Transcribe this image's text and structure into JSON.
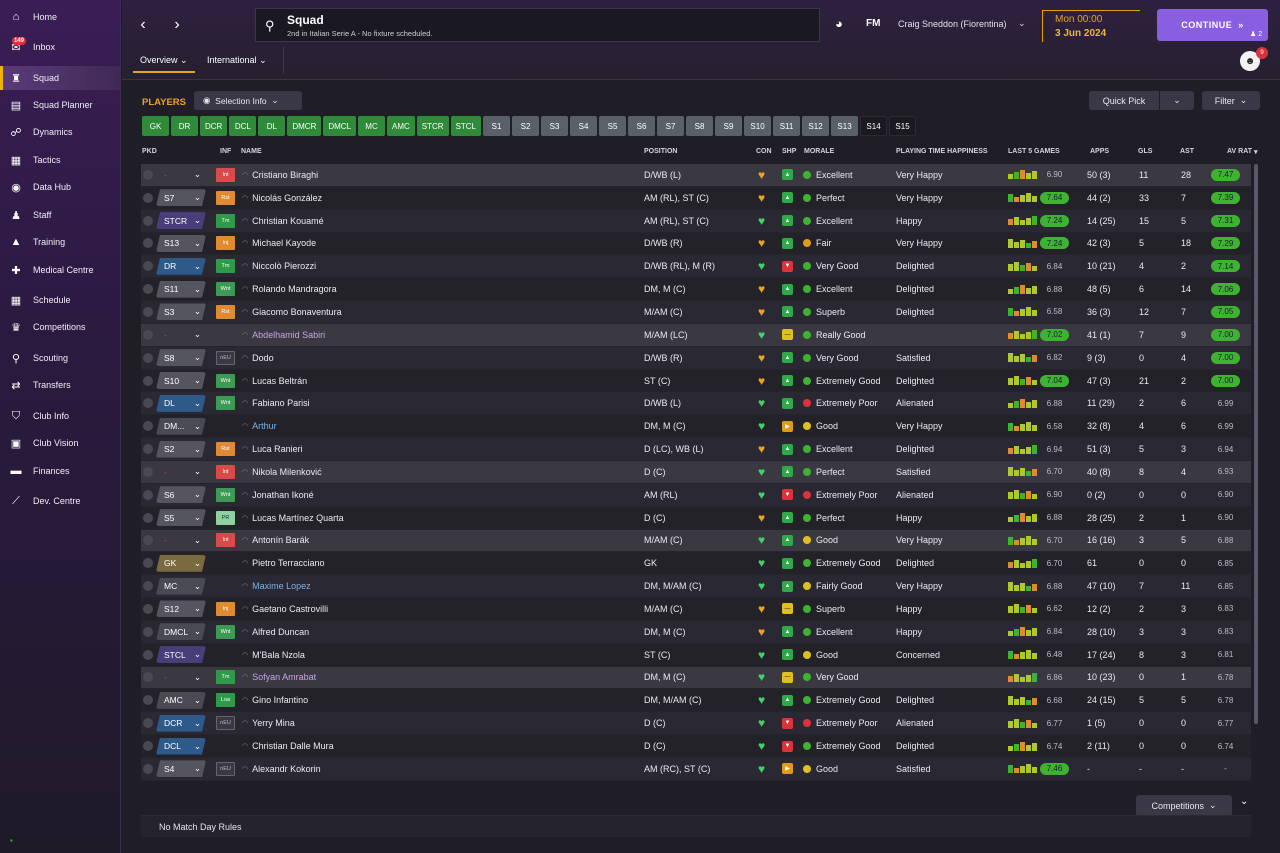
{
  "sidebar": {
    "items": [
      {
        "label": "Home",
        "icon": "home-icon",
        "glyph": "⌂"
      },
      {
        "label": "Inbox",
        "icon": "inbox-icon",
        "glyph": "✉",
        "badge": "149"
      },
      {
        "label": "Squad",
        "icon": "squad-icon",
        "glyph": "♜",
        "active": true
      },
      {
        "label": "Squad Planner",
        "icon": "planner-icon",
        "glyph": "▤"
      },
      {
        "label": "Dynamics",
        "icon": "dynamics-icon",
        "glyph": "☍"
      },
      {
        "label": "Tactics",
        "icon": "tactics-icon",
        "glyph": "▦"
      },
      {
        "label": "Data Hub",
        "icon": "datahub-icon",
        "glyph": "◉"
      },
      {
        "label": "Staff",
        "icon": "staff-icon",
        "glyph": "♟"
      },
      {
        "label": "Training",
        "icon": "training-icon",
        "glyph": "▲"
      },
      {
        "label": "Medical Centre",
        "icon": "medical-icon",
        "glyph": "✚"
      },
      {
        "label": "Schedule",
        "icon": "schedule-icon",
        "glyph": "▦"
      },
      {
        "label": "Competitions",
        "icon": "trophy-icon",
        "glyph": "♛"
      },
      {
        "label": "Scouting",
        "icon": "scouting-icon",
        "glyph": "⚲"
      },
      {
        "label": "Transfers",
        "icon": "transfers-icon",
        "glyph": "⇄"
      },
      {
        "label": "Club Info",
        "icon": "club-info-icon",
        "glyph": "⛉"
      },
      {
        "label": "Club Vision",
        "icon": "club-vision-icon",
        "glyph": "▣"
      },
      {
        "label": "Finances",
        "icon": "finances-icon",
        "glyph": "▬"
      },
      {
        "label": "Dev. Centre",
        "icon": "dev-centre-icon",
        "glyph": "⟋"
      }
    ]
  },
  "header": {
    "title": "Squad",
    "subtitle": "2nd in Italian Serie A - No fixture scheduled.",
    "fm": "FM",
    "manager": "Craig Sneddon (Fiorentina)",
    "time": "Mon 00:00",
    "date": "3 Jun 2024",
    "continue": "CONTINUE",
    "users": "2",
    "notifications": "9"
  },
  "tabs": [
    "Overview",
    "International"
  ],
  "toolbar": {
    "players": "PLAYERS",
    "selection_info": "Selection Info",
    "quick_pick": "Quick Pick",
    "filter": "Filter"
  },
  "positions": [
    {
      "label": "GK",
      "style": "g"
    },
    {
      "label": "DR",
      "style": "g"
    },
    {
      "label": "DCR",
      "style": "g"
    },
    {
      "label": "DCL",
      "style": "g"
    },
    {
      "label": "DL",
      "style": "g"
    },
    {
      "label": "DMCR",
      "style": "g"
    },
    {
      "label": "DMCL",
      "style": "g"
    },
    {
      "label": "MC",
      "style": "g"
    },
    {
      "label": "AMC",
      "style": "g"
    },
    {
      "label": "STCR",
      "style": "g"
    },
    {
      "label": "STCL",
      "style": "g"
    },
    {
      "label": "S1",
      "style": "s"
    },
    {
      "label": "S2",
      "style": "s"
    },
    {
      "label": "S3",
      "style": "s"
    },
    {
      "label": "S4",
      "style": "s"
    },
    {
      "label": "S5",
      "style": "s"
    },
    {
      "label": "S6",
      "style": "s"
    },
    {
      "label": "S7",
      "style": "s"
    },
    {
      "label": "S8",
      "style": "s"
    },
    {
      "label": "S9",
      "style": "s"
    },
    {
      "label": "S10",
      "style": "s"
    },
    {
      "label": "S11",
      "style": "s"
    },
    {
      "label": "S12",
      "style": "s"
    },
    {
      "label": "S13",
      "style": "s"
    },
    {
      "label": "S14",
      "style": "d"
    },
    {
      "label": "S15",
      "style": "d"
    }
  ],
  "columns": [
    "PKD",
    "INF",
    "NAME",
    "POSITION",
    "CON",
    "SHP",
    "MORALE",
    "PLAYING TIME HAPPINESS",
    "LAST 5 GAMES",
    "APPS",
    "GLS",
    "AST",
    "AV RAT"
  ],
  "rows": [
    {
      "pkd": "-",
      "inf": "Int",
      "name": "Cristiano Biraghi",
      "pos": "D/WB (L)",
      "con": "orange",
      "shp": "g",
      "morale": "Excellent",
      "mc": "g",
      "pth": "Very Happy",
      "form": "6.90",
      "fh": false,
      "apps": "50 (3)",
      "gls": "11",
      "ast": "28",
      "rat": "7.47",
      "rh": true
    },
    {
      "pkd": "S7",
      "inf": "Rst",
      "name": "Nicolás González",
      "pos": "AM (RL), ST (C)",
      "con": "orange",
      "shp": "g",
      "morale": "Perfect",
      "mc": "g",
      "pth": "Very Happy",
      "form": "7.64",
      "fh": true,
      "apps": "44 (2)",
      "gls": "33",
      "ast": "7",
      "rat": "7.39",
      "rh": true
    },
    {
      "pkd": "STCR",
      "inf": "Tm",
      "name": "Christian Kouamé",
      "pos": "AM (RL), ST (C)",
      "con": "green",
      "shp": "g",
      "morale": "Excellent",
      "mc": "g",
      "pth": "Happy",
      "form": "7.24",
      "fh": true,
      "apps": "14 (25)",
      "gls": "15",
      "ast": "5",
      "rat": "7.31",
      "rh": true
    },
    {
      "pkd": "S13",
      "inf": "Inj",
      "name": "Michael Kayode",
      "pos": "D/WB (R)",
      "con": "orange",
      "shp": "g",
      "morale": "Fair",
      "mc": "o",
      "pth": "Very Happy",
      "form": "7.24",
      "fh": true,
      "apps": "42 (3)",
      "gls": "5",
      "ast": "18",
      "rat": "7.29",
      "rh": true
    },
    {
      "pkd": "DR",
      "inf": "Tm",
      "name": "Niccolò Pierozzi",
      "pos": "D/WB (RL), M (R)",
      "con": "green",
      "shp": "r",
      "morale": "Very Good",
      "mc": "g",
      "pth": "Delighted",
      "form": "6.84",
      "fh": false,
      "apps": "10 (21)",
      "gls": "4",
      "ast": "2",
      "rat": "7.14",
      "rh": true
    },
    {
      "pkd": "S11",
      "inf": "Wnt",
      "name": "Rolando Mandragora",
      "pos": "DM, M (C)",
      "con": "orange",
      "shp": "g",
      "morale": "Excellent",
      "mc": "g",
      "pth": "Delighted",
      "form": "6.88",
      "fh": false,
      "apps": "48 (5)",
      "gls": "6",
      "ast": "14",
      "rat": "7.06",
      "rh": true
    },
    {
      "pkd": "S3",
      "inf": "Rst",
      "name": "Giacomo Bonaventura",
      "pos": "M/AM (C)",
      "con": "orange",
      "shp": "g",
      "morale": "Superb",
      "mc": "g",
      "pth": "Delighted",
      "form": "6.58",
      "fh": false,
      "apps": "36 (3)",
      "gls": "12",
      "ast": "7",
      "rat": "7.05",
      "rh": true
    },
    {
      "pkd": "-",
      "inf": "",
      "name": "Abdelhamid Sabiri",
      "pos": "M/AM (LC)",
      "con": "green",
      "shp": "y",
      "morale": "Really Good",
      "mc": "g",
      "pth": "",
      "form": "7.02",
      "fh": true,
      "apps": "41 (1)",
      "gls": "7",
      "ast": "9",
      "rat": "7.00",
      "rh": true
    },
    {
      "pkd": "S8",
      "inf": "nEU",
      "name": "Dodo",
      "pos": "D/WB (R)",
      "con": "orange",
      "shp": "g",
      "morale": "Very Good",
      "mc": "g",
      "pth": "Satisfied",
      "form": "6.82",
      "fh": false,
      "apps": "9 (3)",
      "gls": "0",
      "ast": "4",
      "rat": "7.00",
      "rh": true
    },
    {
      "pkd": "S10",
      "inf": "Wnt",
      "name": "Lucas Beltrán",
      "pos": "ST (C)",
      "con": "orange",
      "shp": "g",
      "morale": "Extremely Good",
      "mc": "g",
      "pth": "Delighted",
      "form": "7.04",
      "fh": true,
      "apps": "47 (3)",
      "gls": "21",
      "ast": "2",
      "rat": "7.00",
      "rh": true
    },
    {
      "pkd": "DL",
      "inf": "Wnt",
      "name": "Fabiano Parisi",
      "pos": "D/WB (L)",
      "con": "green",
      "shp": "g",
      "morale": "Extremely Poor",
      "mc": "r",
      "pth": "Alienated",
      "form": "6.88",
      "fh": false,
      "apps": "11 (29)",
      "gls": "2",
      "ast": "6",
      "rat": "6.99",
      "rh": false
    },
    {
      "pkd": "DM...",
      "inf": "",
      "name": "Arthur",
      "pos": "DM, M (C)",
      "con": "green",
      "shp": "o",
      "morale": "Good",
      "mc": "y",
      "pth": "Very Happy",
      "form": "6.58",
      "fh": false,
      "apps": "32 (8)",
      "gls": "4",
      "ast": "6",
      "rat": "6.99",
      "rh": false
    },
    {
      "pkd": "S2",
      "inf": "Rst",
      "name": "Luca Ranieri",
      "pos": "D (LC), WB (L)",
      "con": "orange",
      "shp": "g",
      "morale": "Excellent",
      "mc": "g",
      "pth": "Delighted",
      "form": "6.94",
      "fh": false,
      "apps": "51 (3)",
      "gls": "5",
      "ast": "3",
      "rat": "6.94",
      "rh": false
    },
    {
      "pkd": "-",
      "inf": "Int",
      "name": "Nikola Milenković",
      "pos": "D (C)",
      "con": "green",
      "shp": "g",
      "morale": "Perfect",
      "mc": "g",
      "pth": "Satisfied",
      "form": "6.70",
      "fh": false,
      "apps": "40 (8)",
      "gls": "8",
      "ast": "4",
      "rat": "6.93",
      "rh": false
    },
    {
      "pkd": "S6",
      "inf": "Wnt",
      "name": "Jonathan Ikoné",
      "pos": "AM (RL)",
      "con": "green",
      "shp": "r",
      "morale": "Extremely Poor",
      "mc": "r",
      "pth": "Alienated",
      "form": "6.90",
      "fh": false,
      "apps": "0 (2)",
      "gls": "0",
      "ast": "0",
      "rat": "6.90",
      "rh": false
    },
    {
      "pkd": "S5",
      "inf": "PR",
      "name": "Lucas Martínez Quarta",
      "pos": "D (C)",
      "con": "orange",
      "shp": "g",
      "morale": "Perfect",
      "mc": "g",
      "pth": "Happy",
      "form": "6.88",
      "fh": false,
      "apps": "28 (25)",
      "gls": "2",
      "ast": "1",
      "rat": "6.90",
      "rh": false
    },
    {
      "pkd": "-",
      "inf": "Int",
      "name": "Antonín Barák",
      "pos": "M/AM (C)",
      "con": "green",
      "shp": "g",
      "morale": "Good",
      "mc": "y",
      "pth": "Very Happy",
      "form": "6.70",
      "fh": false,
      "apps": "16 (16)",
      "gls": "3",
      "ast": "5",
      "rat": "6.88",
      "rh": false
    },
    {
      "pkd": "GK",
      "inf": "",
      "name": "Pietro Terracciano",
      "pos": "GK",
      "con": "green",
      "shp": "g",
      "morale": "Extremely Good",
      "mc": "g",
      "pth": "Delighted",
      "form": "6.70",
      "fh": false,
      "apps": "61",
      "gls": "0",
      "ast": "0",
      "rat": "6.85",
      "rh": false
    },
    {
      "pkd": "MC",
      "inf": "",
      "name": "Maxime Lopez",
      "pos": "DM, M/AM (C)",
      "con": "green",
      "shp": "g",
      "morale": "Fairly Good",
      "mc": "y",
      "pth": "Very Happy",
      "form": "6.88",
      "fh": false,
      "apps": "47 (10)",
      "gls": "7",
      "ast": "11",
      "rat": "6.85",
      "rh": false
    },
    {
      "pkd": "S12",
      "inf": "Inj",
      "name": "Gaetano Castrovilli",
      "pos": "M/AM (C)",
      "con": "orange",
      "shp": "y",
      "morale": "Superb",
      "mc": "g",
      "pth": "Happy",
      "form": "6.62",
      "fh": false,
      "apps": "12 (2)",
      "gls": "2",
      "ast": "3",
      "rat": "6.83",
      "rh": false
    },
    {
      "pkd": "DMCL",
      "inf": "Wnt",
      "name": "Alfred Duncan",
      "pos": "DM, M (C)",
      "con": "orange",
      "shp": "g",
      "morale": "Excellent",
      "mc": "g",
      "pth": "Happy",
      "form": "6.84",
      "fh": false,
      "apps": "28 (10)",
      "gls": "3",
      "ast": "3",
      "rat": "6.83",
      "rh": false
    },
    {
      "pkd": "STCL",
      "inf": "",
      "name": "M'Bala Nzola",
      "pos": "ST (C)",
      "con": "green",
      "shp": "g",
      "morale": "Good",
      "mc": "y",
      "pth": "Concerned",
      "form": "6.48",
      "fh": false,
      "apps": "17 (24)",
      "gls": "8",
      "ast": "3",
      "rat": "6.81",
      "rh": false
    },
    {
      "pkd": "-",
      "inf": "Tm",
      "name": "Sofyan Amrabat",
      "pos": "DM, M (C)",
      "con": "green",
      "shp": "y",
      "morale": "Very Good",
      "mc": "g",
      "pth": "",
      "form": "6.86",
      "fh": false,
      "apps": "10 (23)",
      "gls": "0",
      "ast": "1",
      "rat": "6.78",
      "rh": false
    },
    {
      "pkd": "AMC",
      "inf": "Loa",
      "name": "Gino Infantino",
      "pos": "DM, M/AM (C)",
      "con": "green",
      "shp": "g",
      "morale": "Extremely Good",
      "mc": "g",
      "pth": "Delighted",
      "form": "6.68",
      "fh": false,
      "apps": "24 (15)",
      "gls": "5",
      "ast": "5",
      "rat": "6.78",
      "rh": false
    },
    {
      "pkd": "DCR",
      "inf": "nEU",
      "name": "Yerry Mina",
      "pos": "D (C)",
      "con": "green",
      "shp": "r",
      "morale": "Extremely Poor",
      "mc": "r",
      "pth": "Alienated",
      "form": "6.77",
      "fh": false,
      "apps": "1 (5)",
      "gls": "0",
      "ast": "0",
      "rat": "6.77",
      "rh": false
    },
    {
      "pkd": "DCL",
      "inf": "",
      "name": "Christian Dalle Mura",
      "pos": "D (C)",
      "con": "green",
      "shp": "r",
      "morale": "Extremely Good",
      "mc": "g",
      "pth": "Delighted",
      "form": "6.74",
      "fh": false,
      "apps": "2 (11)",
      "gls": "0",
      "ast": "0",
      "rat": "6.74",
      "rh": false
    },
    {
      "pkd": "S4",
      "inf": "nEU",
      "name": "Alexandr Kokorin",
      "pos": "AM (RC), ST (C)",
      "con": "green",
      "shp": "o",
      "morale": "Good",
      "mc": "y",
      "pth": "Satisfied",
      "form": "7.46",
      "fh": true,
      "apps": "-",
      "gls": "-",
      "ast": "-",
      "rat": "-",
      "rh": false
    }
  ],
  "footer": {
    "competitions": "Competitions",
    "rules": "No Match Day Rules"
  },
  "colors": {
    "accent": "#8a5ee0",
    "orange": "#f0a21c",
    "green": "#3fb232",
    "red": "#d9343b"
  }
}
